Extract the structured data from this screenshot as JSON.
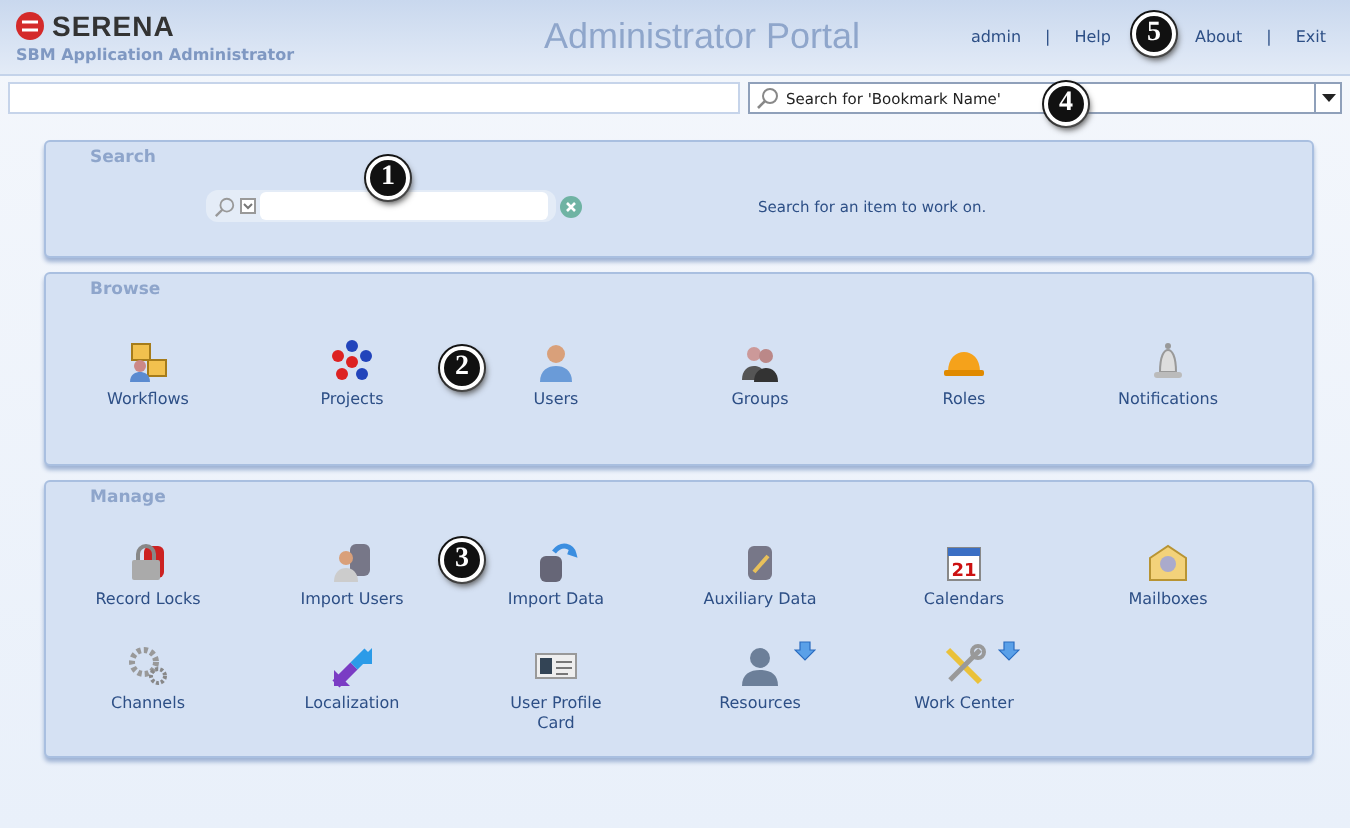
{
  "header": {
    "brand": "SERENA",
    "subtitle": "SBM Application Administrator",
    "title": "Administrator Portal",
    "links": [
      {
        "label": "admin",
        "separator": "|"
      },
      {
        "label": "Help"
      },
      {
        "label": "About",
        "separator": "|"
      },
      {
        "label": "Exit"
      }
    ]
  },
  "bookmark_bar": {
    "placeholder": "Search for 'Bookmark Name'"
  },
  "search_panel": {
    "title": "Search",
    "hint": "Search for an item to work on."
  },
  "browse_panel": {
    "title": "Browse",
    "items": [
      {
        "label": "Workflows",
        "expandable": false
      },
      {
        "label": "Projects",
        "expandable": false
      },
      {
        "label": "Users",
        "expandable": false
      },
      {
        "label": "Groups",
        "expandable": false
      },
      {
        "label": "Roles",
        "expandable": false
      },
      {
        "label": "Notifications",
        "expandable": false
      }
    ]
  },
  "manage_panel": {
    "title": "Manage",
    "items": [
      {
        "label": "Record Locks",
        "expandable": false
      },
      {
        "label": "Import Users",
        "expandable": false
      },
      {
        "label": "Import Data",
        "expandable": false
      },
      {
        "label": "Auxiliary Data",
        "expandable": false
      },
      {
        "label": "Calendars",
        "expandable": false,
        "badge": "21"
      },
      {
        "label": "Mailboxes",
        "expandable": false
      },
      {
        "label": "Channels",
        "expandable": false
      },
      {
        "label": "Localization",
        "expandable": false
      },
      {
        "label": "User Profile Card",
        "expandable": false
      },
      {
        "label": "Resources",
        "expandable": true
      },
      {
        "label": "Work Center",
        "expandable": true
      }
    ]
  },
  "callouts": [
    "1",
    "2",
    "3",
    "4",
    "5"
  ]
}
